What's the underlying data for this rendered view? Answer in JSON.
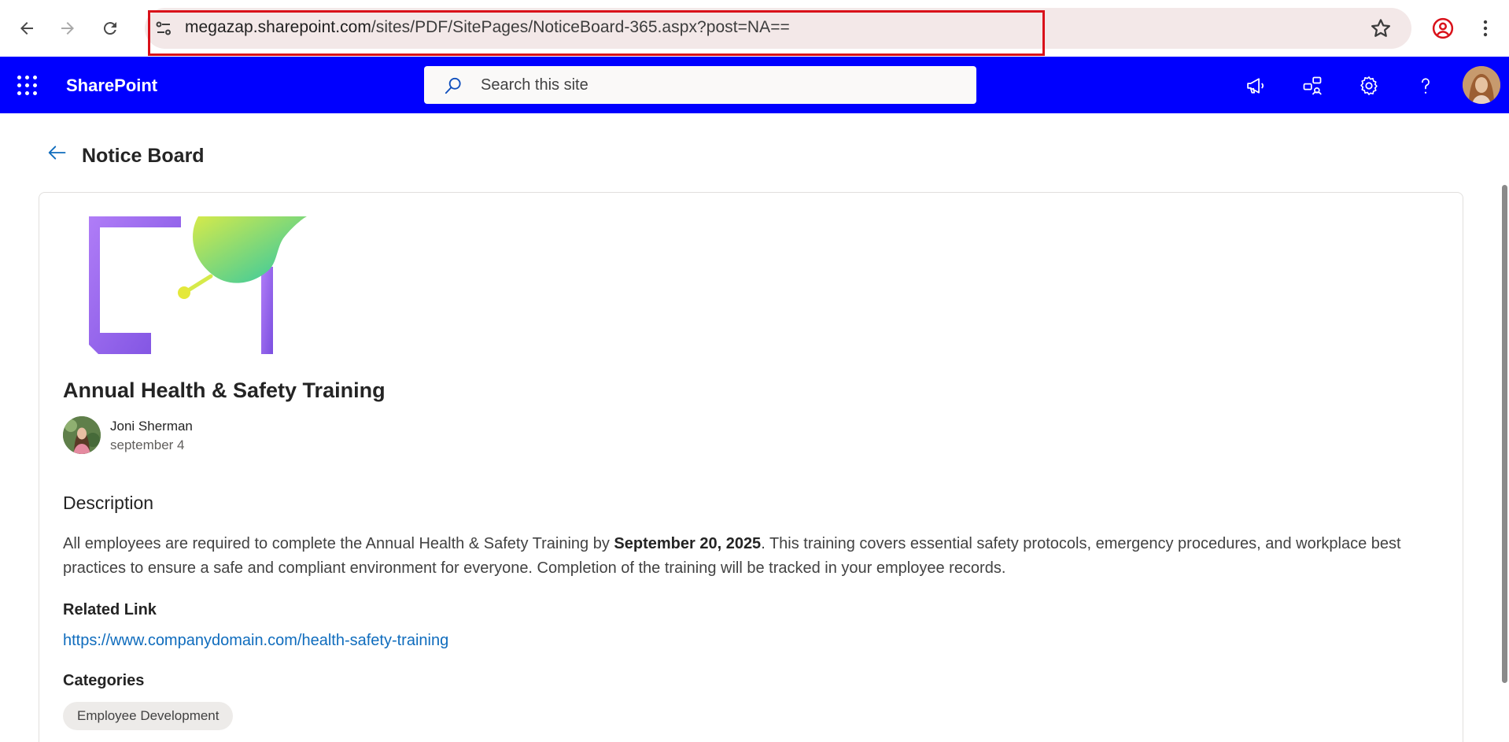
{
  "browser": {
    "url_domain": "megazap.sharepoint.com",
    "url_path": "/sites/PDF/SitePages/NoticeBoard-365.aspx?post=NA=="
  },
  "suitebar": {
    "brand": "SharePoint",
    "search_placeholder": "Search this site",
    "background_color": "#0000ff"
  },
  "page": {
    "title": "Notice Board"
  },
  "post": {
    "title": "Annual Health & Safety Training",
    "author": "Joni Sherman",
    "date": "september 4",
    "description_heading": "Description",
    "description_before": "All employees are required to complete the Annual Health & Safety Training by ",
    "description_bold": "September 20, 2025",
    "description_after": ". This training covers essential safety protocols, emergency procedures, and workplace best practices to ensure a safe and compliant environment for everyone. Completion of the training will be tracked in your employee records.",
    "related_link_label": "Related Link",
    "related_link_url": "https://www.companydomain.com/health-safety-training",
    "categories_label": "Categories",
    "categories": [
      "Employee Development"
    ]
  },
  "icons": {
    "back": "back-arrow-icon",
    "forward": "forward-arrow-icon",
    "reload": "reload-icon",
    "site_settings": "tune-icon",
    "bookmark": "star-icon",
    "profile": "profile-icon",
    "more": "more-vertical-icon",
    "app_launcher": "waffle-icon",
    "search": "search-icon",
    "announcements": "megaphone-icon",
    "share": "share-icon",
    "settings": "gear-icon",
    "help": "help-icon"
  }
}
